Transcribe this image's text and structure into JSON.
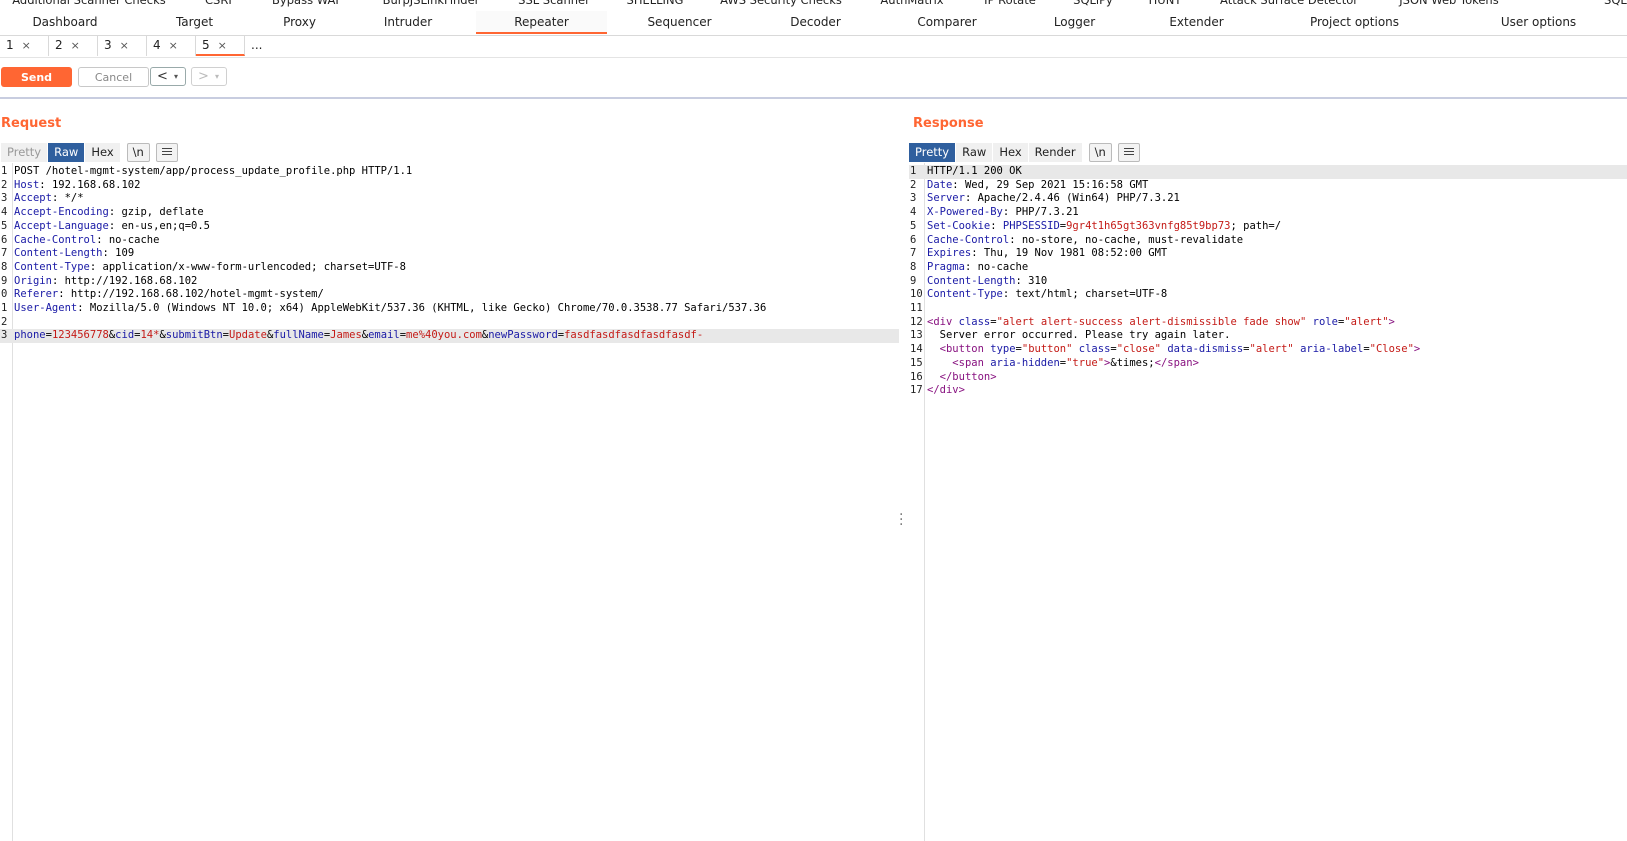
{
  "extension_tabs": [
    "Additional Scanner Checks",
    "CSRF",
    "Bypass WAF",
    "BurpJSLinkFinder",
    "SSL Scanner",
    "SHELLING",
    "AWS Security Checks",
    "AuthMatrix",
    "IP Rotate",
    "SQLiPy",
    "HUNT",
    "Attack Surface Detector",
    "JSON Web Tokens",
    "SQLi"
  ],
  "main_tabs": [
    "Dashboard",
    "Target",
    "Proxy",
    "Intruder",
    "Repeater",
    "Sequencer",
    "Decoder",
    "Comparer",
    "Logger",
    "Extender",
    "Project options",
    "User options"
  ],
  "active_main_tab": "Repeater",
  "repeater_tabs": [
    "1",
    "2",
    "3",
    "4",
    "5"
  ],
  "repeater_tab_close": "×",
  "repeater_more": "...",
  "toolbar": {
    "send_label": "Send",
    "cancel_label": "Cancel",
    "back_label": "<",
    "forward_label": ">",
    "dropdown_glyph": "▾"
  },
  "request": {
    "title": "Request",
    "view_tabs": [
      "Pretty",
      "Raw",
      "Hex"
    ],
    "active_view": "Raw",
    "newline_label": "\\n",
    "lines": [
      {
        "n": "1",
        "k": "",
        "v": "POST /hotel-mgmt-system/app/process_update_profile.php HTTP/1.1"
      },
      {
        "n": "2",
        "k": "Host",
        "v": "192.168.68.102"
      },
      {
        "n": "3",
        "k": "Accept",
        "v": "*/*"
      },
      {
        "n": "4",
        "k": "Accept-Encoding",
        "v": "gzip, deflate"
      },
      {
        "n": "5",
        "k": "Accept-Language",
        "v": "en-us,en;q=0.5"
      },
      {
        "n": "6",
        "k": "Cache-Control",
        "v": "no-cache"
      },
      {
        "n": "7",
        "k": "Content-Length",
        "v": "109"
      },
      {
        "n": "8",
        "k": "Content-Type",
        "v": "application/x-www-form-urlencoded; charset=UTF-8"
      },
      {
        "n": "9",
        "k": "Origin",
        "v": "http://192.168.68.102"
      },
      {
        "n": "0",
        "k": "Referer",
        "v": "http://192.168.68.102/hotel-mgmt-system/"
      },
      {
        "n": "1",
        "k": "User-Agent",
        "v": "Mozilla/5.0 (Windows NT 10.0; x64) AppleWebKit/537.36 (KHTML, like Gecko) Chrome/70.0.3538.77 Safari/537.36"
      },
      {
        "n": "2",
        "k": "",
        "v": ""
      }
    ],
    "body_line_number": "3",
    "body_params": [
      {
        "k": "phone",
        "v": "123456778"
      },
      {
        "k": "cid",
        "v": "14*"
      },
      {
        "k": "submitBtn",
        "v": "Update"
      },
      {
        "k": "fullName",
        "v": "James"
      },
      {
        "k": "email",
        "v": "me%40you.com"
      },
      {
        "k": "newPassword",
        "v": "fasdfasdfasdfasdfasdf-"
      }
    ]
  },
  "response": {
    "title": "Response",
    "view_tabs": [
      "Pretty",
      "Raw",
      "Hex",
      "Render"
    ],
    "active_view": "Pretty",
    "newline_label": "\\n",
    "status_line": "HTTP/1.1 200 OK",
    "headers": [
      {
        "n": "2",
        "k": "Date",
        "v": "Wed, 29 Sep 2021 15:16:58 GMT"
      },
      {
        "n": "3",
        "k": "Server",
        "v": "Apache/2.4.46 (Win64) PHP/7.3.21"
      },
      {
        "n": "4",
        "k": "X-Powered-By",
        "v": "PHP/7.3.21"
      },
      {
        "n": "6",
        "k": "Cache-Control",
        "v": "no-store, no-cache, must-revalidate"
      },
      {
        "n": "7",
        "k": "Expires",
        "v": "Thu, 19 Nov 1981 08:52:00 GMT"
      },
      {
        "n": "8",
        "k": "Pragma",
        "v": "no-cache"
      },
      {
        "n": "9",
        "k": "Content-Length",
        "v": "310"
      },
      {
        "n": "10",
        "k": "Content-Type",
        "v": "text/html; charset=UTF-8"
      }
    ],
    "cookie": {
      "n": "5",
      "k": "Set-Cookie",
      "name": "PHPSESSID",
      "value": "9gr4t1h65gt363vnfg85t9bp73",
      "rest": "; path=/"
    },
    "body_numbers": [
      "11",
      "12",
      "13",
      "14",
      "15",
      "16",
      "17"
    ],
    "div_open": {
      "attrs": [
        {
          "a": "class",
          "v": "\"alert alert-success alert-dismissible fade show\""
        },
        {
          "a": "role",
          "v": "\"alert\""
        }
      ]
    },
    "message": "Server error occurred. Please try again later.",
    "button_open": {
      "attrs": [
        {
          "a": "type",
          "v": "\"button\""
        },
        {
          "a": "class",
          "v": "\"close\""
        },
        {
          "a": "data-dismiss",
          "v": "\"alert\""
        },
        {
          "a": "aria-label",
          "v": "\"Close\""
        }
      ]
    },
    "span_attr": {
      "a": "aria-hidden",
      "v": "\"true\""
    },
    "span_text": "&times;",
    "colors": {
      "accent": "#ff6633",
      "active_view": "#2f5f9e"
    }
  }
}
